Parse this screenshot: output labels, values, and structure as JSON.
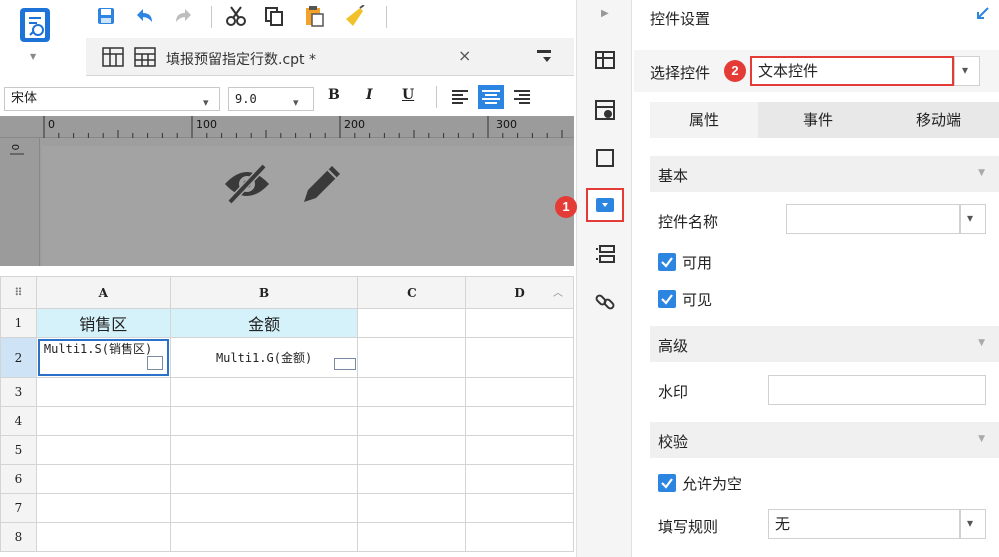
{
  "tab": {
    "title": "填报预留指定行数.cpt *",
    "close_glyph": "×"
  },
  "format": {
    "font_name": "宋体",
    "font_size": "9.0",
    "bold": "B",
    "italic": "I",
    "underline": "U"
  },
  "ruler": {
    "labels": [
      "0",
      "100",
      "200",
      "300"
    ]
  },
  "sheet": {
    "corner": "⠿",
    "columns": [
      "A",
      "B",
      "C",
      "D"
    ],
    "rows": [
      "1",
      "2",
      "3",
      "4",
      "5",
      "6",
      "7",
      "8"
    ],
    "a1": "销售区",
    "b1": "金额",
    "a2": "Multi1.S(销售区)",
    "b2": "Multi1.G(金额)"
  },
  "badges": {
    "one": "1",
    "two": "2"
  },
  "panel": {
    "title": "控件设置",
    "select_label": "选择控件",
    "select_value": "文本控件",
    "tabs": [
      "属性",
      "事件",
      "移动端"
    ],
    "sections": {
      "basic": "基本",
      "advanced": "高级",
      "validation": "校验"
    },
    "fields": {
      "widget_name_label": "控件名称",
      "enabled_label": "可用",
      "visible_label": "可见",
      "watermark_label": "水印",
      "allow_empty_label": "允许为空",
      "fill_rule_label": "填写规则",
      "fill_rule_value": "无"
    }
  },
  "colors": {
    "accent": "#2c85e0",
    "highlight_red": "#e53b36",
    "header_cell": "#d5f2fb"
  },
  "icons": [
    "app-logo-icon",
    "save-icon",
    "undo-icon",
    "redo-icon",
    "cut-icon",
    "copy-icon",
    "paste-icon",
    "format-painter-icon",
    "sheet-icon",
    "eye-off-icon",
    "pencil-icon",
    "cell-attr-icon",
    "widget-icon",
    "link-icon"
  ]
}
